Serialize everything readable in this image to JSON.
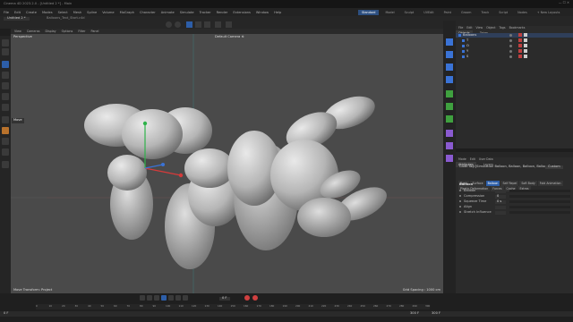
{
  "window": {
    "title": "Cinema 4D 2023.2.0 - [Untitled 2 *] - Main"
  },
  "menubar": {
    "items": [
      "File",
      "Edit",
      "Create",
      "Modes",
      "Select",
      "Mesh",
      "Spline",
      "Volume",
      "MoGraph",
      "Character",
      "Animate",
      "Simulate",
      "Tracker",
      "Render",
      "Extensions",
      "Window",
      "Help"
    ]
  },
  "layouts": {
    "items": [
      "Standard",
      "Model",
      "Sculpt",
      "UVEdit",
      "Paint",
      "Groom",
      "Track",
      "Script",
      "Nodes"
    ],
    "active": "Standard",
    "new_layouts": "+ New Layouts"
  },
  "doc_tabs": [
    "Untitled 2 *",
    "Balloons_Text_Start.c4d"
  ],
  "viewport": {
    "menu": [
      "View",
      "Cameras",
      "Display",
      "Options",
      "Filter",
      "Panel"
    ],
    "label": "Perspective",
    "camera": "Default Camera ✲",
    "status_left": "Move Transform: Project",
    "status_right": "Grid Spacing : 1000 cm",
    "move_tooltip": "Move"
  },
  "objects_panel": {
    "tabs": [
      "Objects",
      "Takes"
    ],
    "menu": [
      "File",
      "Edit",
      "View",
      "Object",
      "Tags",
      "Bookmarks"
    ],
    "items": [
      {
        "name": "Balloons"
      },
      {
        "name": "T"
      },
      {
        "name": "O"
      },
      {
        "name": "Y"
      },
      {
        "name": "S"
      }
    ]
  },
  "attributes_panel": {
    "tabs": [
      "Attributes",
      "Layers"
    ],
    "menu": [
      "Mode",
      "Edit",
      "User Data"
    ],
    "object_line": "Cloth Tag [Simulation Balloon, Balloon, Balloon, Balloon]",
    "mode_value": "Custom",
    "tabs_row1": [
      "Basic",
      "Surface",
      "Balloon",
      "Self Repel",
      "Soft Body",
      "Fold Animation"
    ],
    "tabs_row2": [
      "Plastic Deformation",
      "Forces",
      "Cache",
      "Extras"
    ],
    "active_tab": "Balloon",
    "section": "Balloon",
    "fields": [
      {
        "label": "Balloon",
        "value": ""
      },
      {
        "label": "Compression",
        "value": "0"
      },
      {
        "label": "Squeeze Time",
        "value": "0 s"
      },
      {
        "label": "Align",
        "value": ""
      },
      {
        "label": "Stretch Influence",
        "value": ""
      }
    ]
  },
  "timeline": {
    "current_frame": "0 F",
    "start": "0 F",
    "end": "300 F",
    "end_right": "300 F",
    "ruler": [
      "0",
      "10",
      "20",
      "30",
      "40",
      "50",
      "60",
      "70",
      "80",
      "90",
      "100",
      "110",
      "120",
      "130",
      "140",
      "150",
      "160",
      "170",
      "180",
      "190",
      "200",
      "210",
      "220",
      "230",
      "240",
      "250",
      "260",
      "270",
      "280",
      "290",
      "300"
    ]
  },
  "colors": {
    "accent": "#2d5ea8",
    "active_layout": "#2d4f80",
    "keyframe": "#d04040"
  }
}
